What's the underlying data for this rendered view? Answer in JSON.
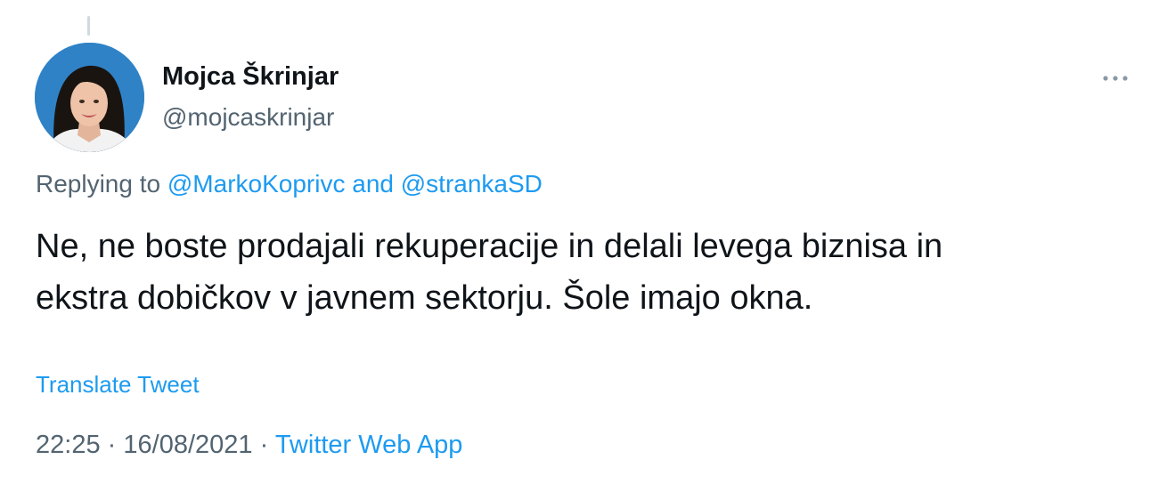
{
  "author": {
    "display_name": "Mojca Škrinjar",
    "handle": "@mojcaskrinjar"
  },
  "icons": {
    "more": "more-horizontal-icon",
    "avatar": "profile-photo"
  },
  "reply": {
    "prefix": "Replying to",
    "mention_1": "@MarkoKoprivc",
    "conjunction": "and",
    "mention_2": "@strankaSD"
  },
  "tweet": {
    "line_1": "Ne, ne boste prodajali rekuperacije in delali levega biznisa in",
    "line_2": "ekstra dobičkov v javnem sektorju. Šole imajo okna."
  },
  "translate_label": "Translate Tweet",
  "meta": {
    "time": "22:25",
    "separator": "·",
    "date": "16/08/2021",
    "source": "Twitter Web App"
  },
  "colors": {
    "link": "#1d9bf0",
    "secondary_text": "#536471",
    "primary_text": "#0f1419",
    "avatar_background": "#2f82c6"
  }
}
